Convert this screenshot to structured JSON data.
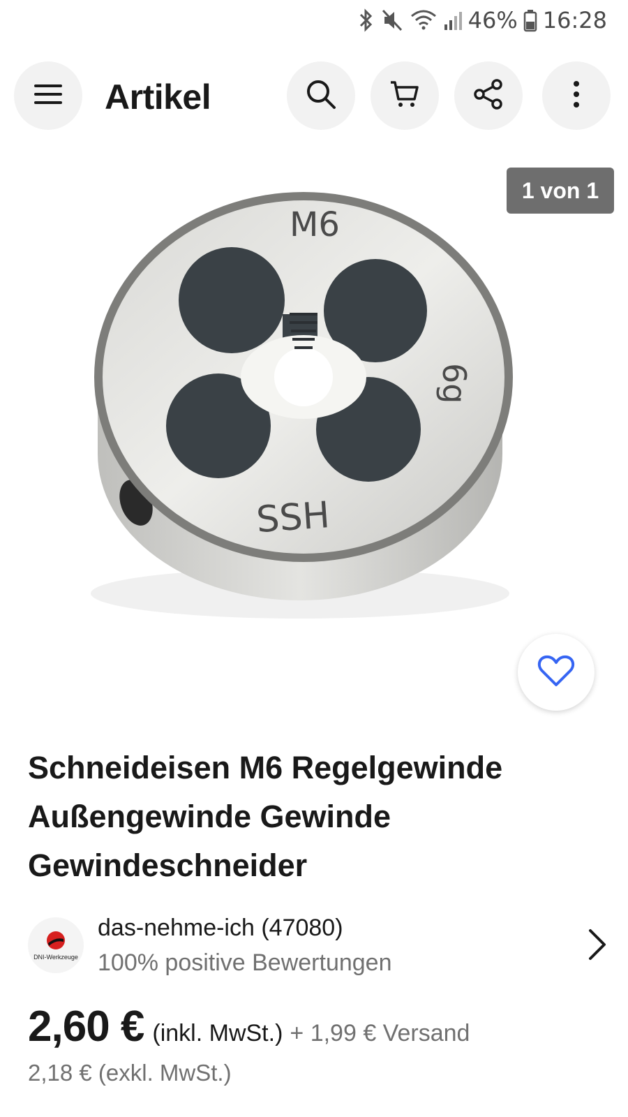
{
  "status_bar": {
    "battery": "46%",
    "time": "16:28",
    "icons": [
      "bluetooth-icon",
      "mute-icon",
      "wifi-icon",
      "signal-icon",
      "battery-icon"
    ]
  },
  "header": {
    "title": "Artikel",
    "icons": [
      "menu-icon",
      "search-icon",
      "cart-icon",
      "share-icon",
      "more-vertical-icon"
    ]
  },
  "gallery": {
    "counter": "1 von 1",
    "image_markings": [
      "M6",
      "6g",
      "SSH"
    ],
    "favorite_icon": "heart-outline-icon",
    "favorite_color": "#3665f3"
  },
  "product": {
    "title_lines": [
      "Schneideisen M6 Regelgewinde",
      "Außengewinde Gewinde",
      "Gewindeschneider"
    ]
  },
  "seller": {
    "logo_caption": "DNI-Werkzeuge",
    "name": "das-nehme-ich (47080)",
    "rating": "100% positive Bewertungen"
  },
  "pricing": {
    "price": "2,60 €",
    "vat_note": "(inkl. MwSt.)",
    "shipping": "+ 1,99 € Versand",
    "net_price": "2,18 € (exkl. MwSt.)"
  },
  "colors": {
    "accent": "#3665f3",
    "secondary_text": "#707070"
  }
}
